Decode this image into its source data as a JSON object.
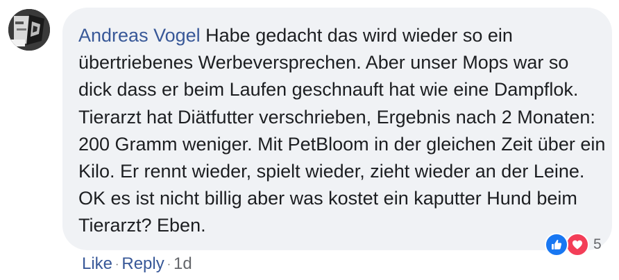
{
  "comment": {
    "author": "Andreas Vogel",
    "text": "Habe gedacht das wird wieder so ein übertriebenes Werbeversprechen. Aber unser Mops war so dick dass er beim Laufen geschnauft hat wie eine Dampflok. Tierarzt hat Diätfutter verschrieben, Ergebnis nach 2 Monaten: 200 Gramm weniger. Mit PetBloom in der gleichen Zeit über ein Kilo. Er rennt wieder, spielt wieder, zieht wieder an der Leine. OK es ist nicht billig aber was kostet ein kaputter Hund beim Tierarzt? Eben."
  },
  "reactions": {
    "icons": [
      "like-icon",
      "love-icon"
    ],
    "count": "5"
  },
  "actions": {
    "like_label": "Like",
    "reply_label": "Reply",
    "separator": "·",
    "timestamp": "1d"
  },
  "colors": {
    "author": "#385898",
    "bubble": "#f0f2f5",
    "text": "#1c1e21",
    "muted": "#65676b",
    "like": "#1877f2",
    "love": "#f33e58"
  }
}
